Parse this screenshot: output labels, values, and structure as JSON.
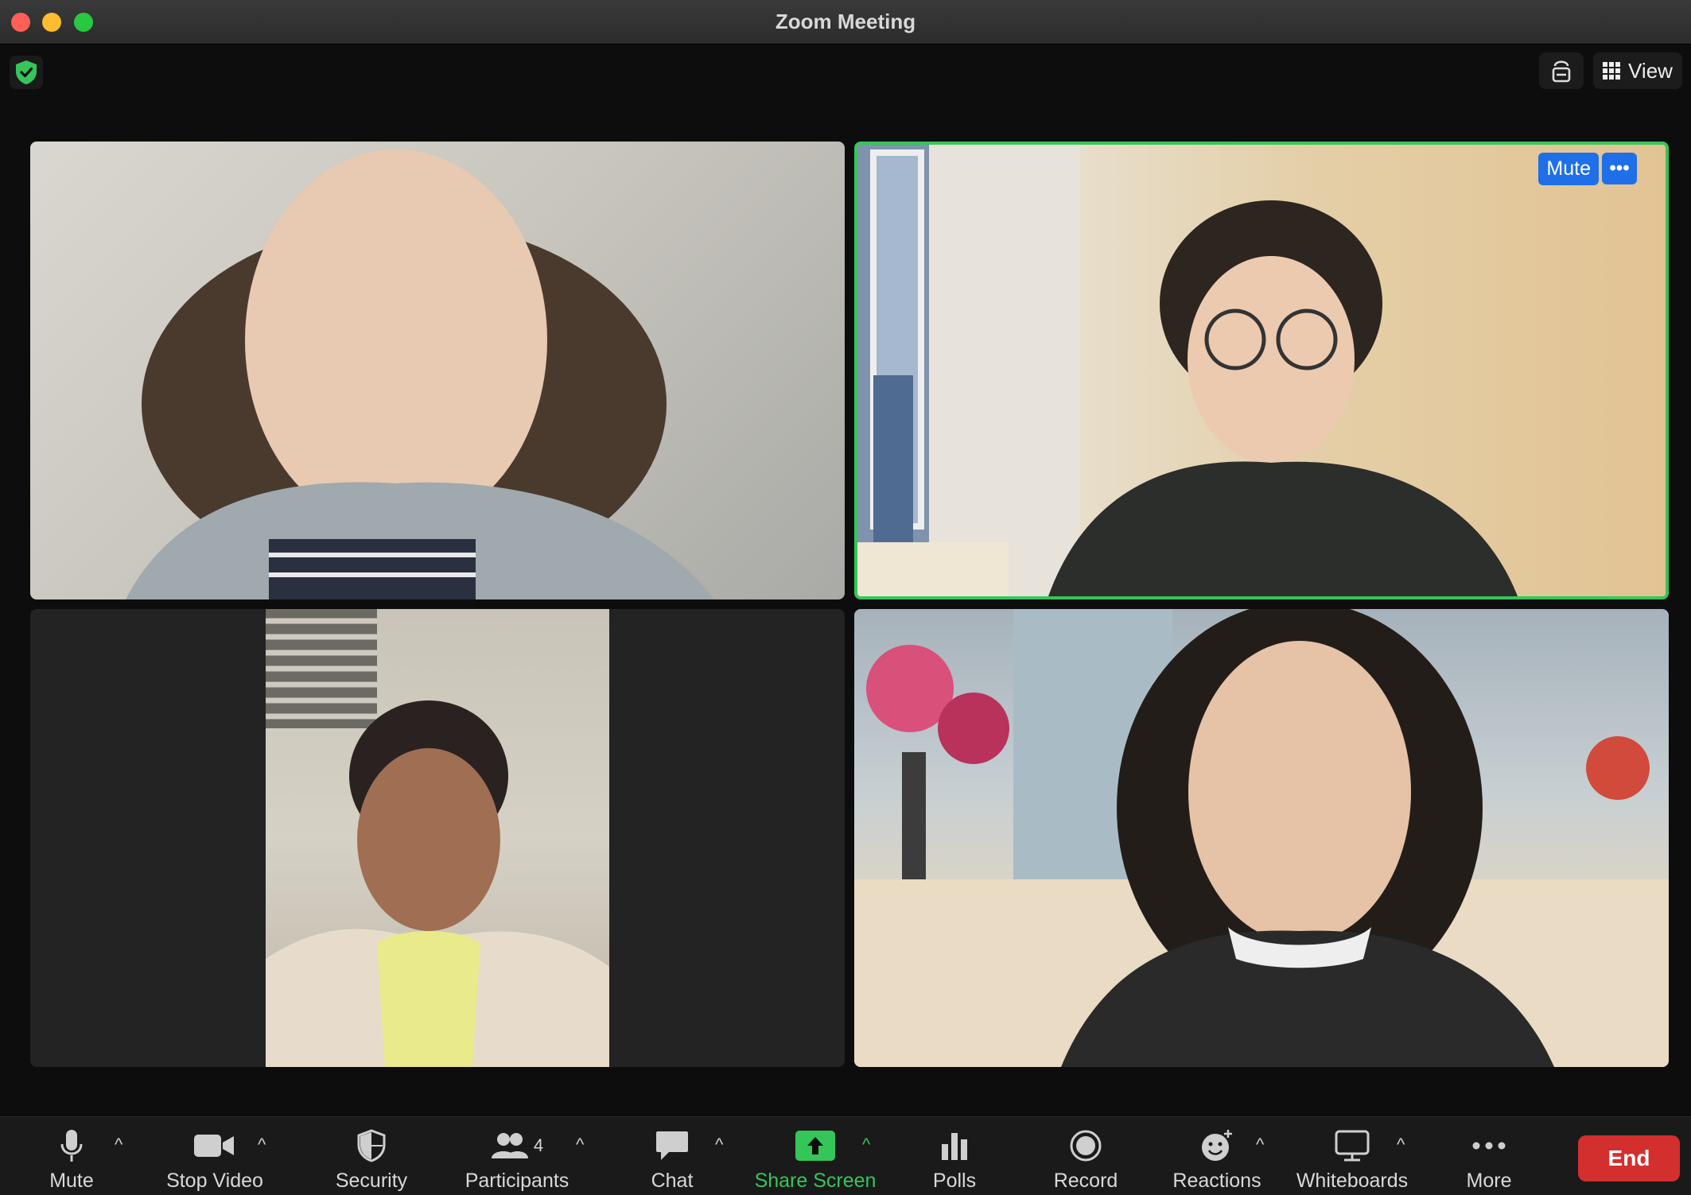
{
  "window": {
    "title": "Zoom Meeting"
  },
  "top_bar": {
    "view_label": "View",
    "security_status": "shield-check-icon"
  },
  "tiles": {
    "active_speaker_overlay": {
      "mute_label": "Mute",
      "more_label": "•••"
    },
    "active_border_color": "#35c65a"
  },
  "toolbar": {
    "mute": "Mute",
    "stop_video": "Stop Video",
    "security": "Security",
    "participants": "Participants",
    "participants_count": "4",
    "chat": "Chat",
    "share_screen": "Share Screen",
    "polls": "Polls",
    "record": "Record",
    "reactions": "Reactions",
    "whiteboards": "Whiteboards",
    "more": "More",
    "end": "End"
  },
  "colors": {
    "accent": "#1e6fe8",
    "share": "#35c65a",
    "end": "#d32f2f"
  }
}
